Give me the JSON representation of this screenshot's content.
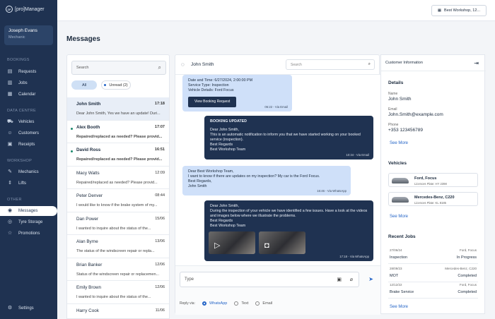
{
  "app": {
    "brand": "ZF",
    "title": "[pro]Manager"
  },
  "user": {
    "name": "Joseph Evans",
    "role": "Mechanic"
  },
  "nav": {
    "bookings_label": "BOOKINGS",
    "requests": "Requests",
    "jobs": "Jobs",
    "calendar": "Calendar",
    "data_centre_label": "DATA CENTRE",
    "vehicles": "Vehicles",
    "customers": "Customers",
    "receipts": "Receipts",
    "workshop_label": "WORKSHOP",
    "mechanics": "Mechanics",
    "lifts": "Lifts",
    "other_label": "OTHER",
    "messages": "Messages",
    "tyre_storage": "Tyre Storage",
    "promotions": "Promotions",
    "settings": "Settings"
  },
  "topbar": {
    "workshop": "Best Workshop, 12..."
  },
  "page": {
    "title": "Messages"
  },
  "list": {
    "search_placeholder": "Search",
    "filter_all": "All",
    "filter_unread": "Unread (2)",
    "items": [
      {
        "name": "John Smith",
        "time": "17:18",
        "preview": "Dear John Smith, Yes we have an update! Duri..."
      },
      {
        "name": "Alex Booth",
        "time": "17:07",
        "preview": "Repaired/replaced as needed? Please provid..."
      },
      {
        "name": "David Ross",
        "time": "16:51",
        "preview": "Repaired/replaced as needed? Please provid..."
      },
      {
        "name": "Macy Watts",
        "time": "12:09",
        "preview": "Repaired/replaced as needed? Please provid..."
      },
      {
        "name": "Peter Denver",
        "time": "08:44",
        "preview": "I would like to know if the brake system of my..."
      },
      {
        "name": "Dan Power",
        "time": "15/06",
        "preview": "I wanted to inquire about the status of the..."
      },
      {
        "name": "Alan Byrne",
        "time": "13/06",
        "preview": "The status of the windscreen repair or repla..."
      },
      {
        "name": "Brian Banker",
        "time": "12/06",
        "preview": "Status of the windscreen repair or replacemen..."
      },
      {
        "name": "Emily Brown",
        "time": "12/06",
        "preview": "I wanted to inquire about the status of the..."
      },
      {
        "name": "Harry Cook",
        "time": "11/06",
        "preview": ""
      }
    ]
  },
  "chat": {
    "contact": "John Smith",
    "search_placeholder": "Search",
    "msg1": {
      "line1": "Date and Time: 6/27/2024, 2:00:00 PM",
      "line2": "Service Type: Inspection",
      "line3": "Vehicle Details: Ford Focus",
      "button": "View Booking Request",
      "meta": "06:22 - Via Email"
    },
    "msg2": {
      "heading": "BOOKING UPDATED",
      "body1": "Dear John Smith,",
      "body2": "This is an automatic notification to inform you that we have started working on your booked service (inspection).",
      "body3": "Best Regards",
      "body4": "Best Workshop Team",
      "meta": "10:34 - Via Email"
    },
    "msg3": {
      "line1": "Dear Best Workshop Team,",
      "line2": "I want to know if there are updates on my inspection? My car is the Ford Focus.",
      "line3": "Best Regards,",
      "line4": "John Smith",
      "meta": "16:46 - Via WhatsApp"
    },
    "msg4": {
      "line1": "Dear John Smith,",
      "line2": "During the inspection of your vehicle we have identified a few issues. Have a look at the videos and images below where we illustrate the problems.",
      "line3": "Best Regards",
      "line4": "Best Workshop Team",
      "meta": "17:18 - Via WhatsApp"
    },
    "composer_placeholder": "Type",
    "reply_via": "Reply via:",
    "opt_whatsapp": "WhatsApp",
    "opt_text": "Text",
    "opt_email": "Email"
  },
  "customer": {
    "header": "Customer Information",
    "details_title": "Details",
    "name_label": "Name",
    "name": "John Smith",
    "email_label": "Email",
    "email": "John.Smith@example.com",
    "phone_label": "Phone",
    "phone": "+353 123456789",
    "see_more": "See More",
    "vehicles_title": "Vehicles",
    "vehicles": [
      {
        "name": "Ford, Focus",
        "plate": "Licences Plate: HY 2398"
      },
      {
        "name": "Mercedes-Benz, C220",
        "plate": "Licences Plate: KL 8185"
      }
    ],
    "jobs_title": "Recent Jobs",
    "jobs": [
      {
        "date": "27/06/24",
        "type": "Inspection",
        "model": "Ford, Focus",
        "status": "In Progress"
      },
      {
        "date": "28/09/23",
        "type": "MOT",
        "model": "Mercedes-Benz, C220",
        "status": "Completed"
      },
      {
        "date": "12/12/22",
        "type": "Brake Service",
        "model": "Ford, Focus",
        "status": "Completed"
      }
    ]
  }
}
